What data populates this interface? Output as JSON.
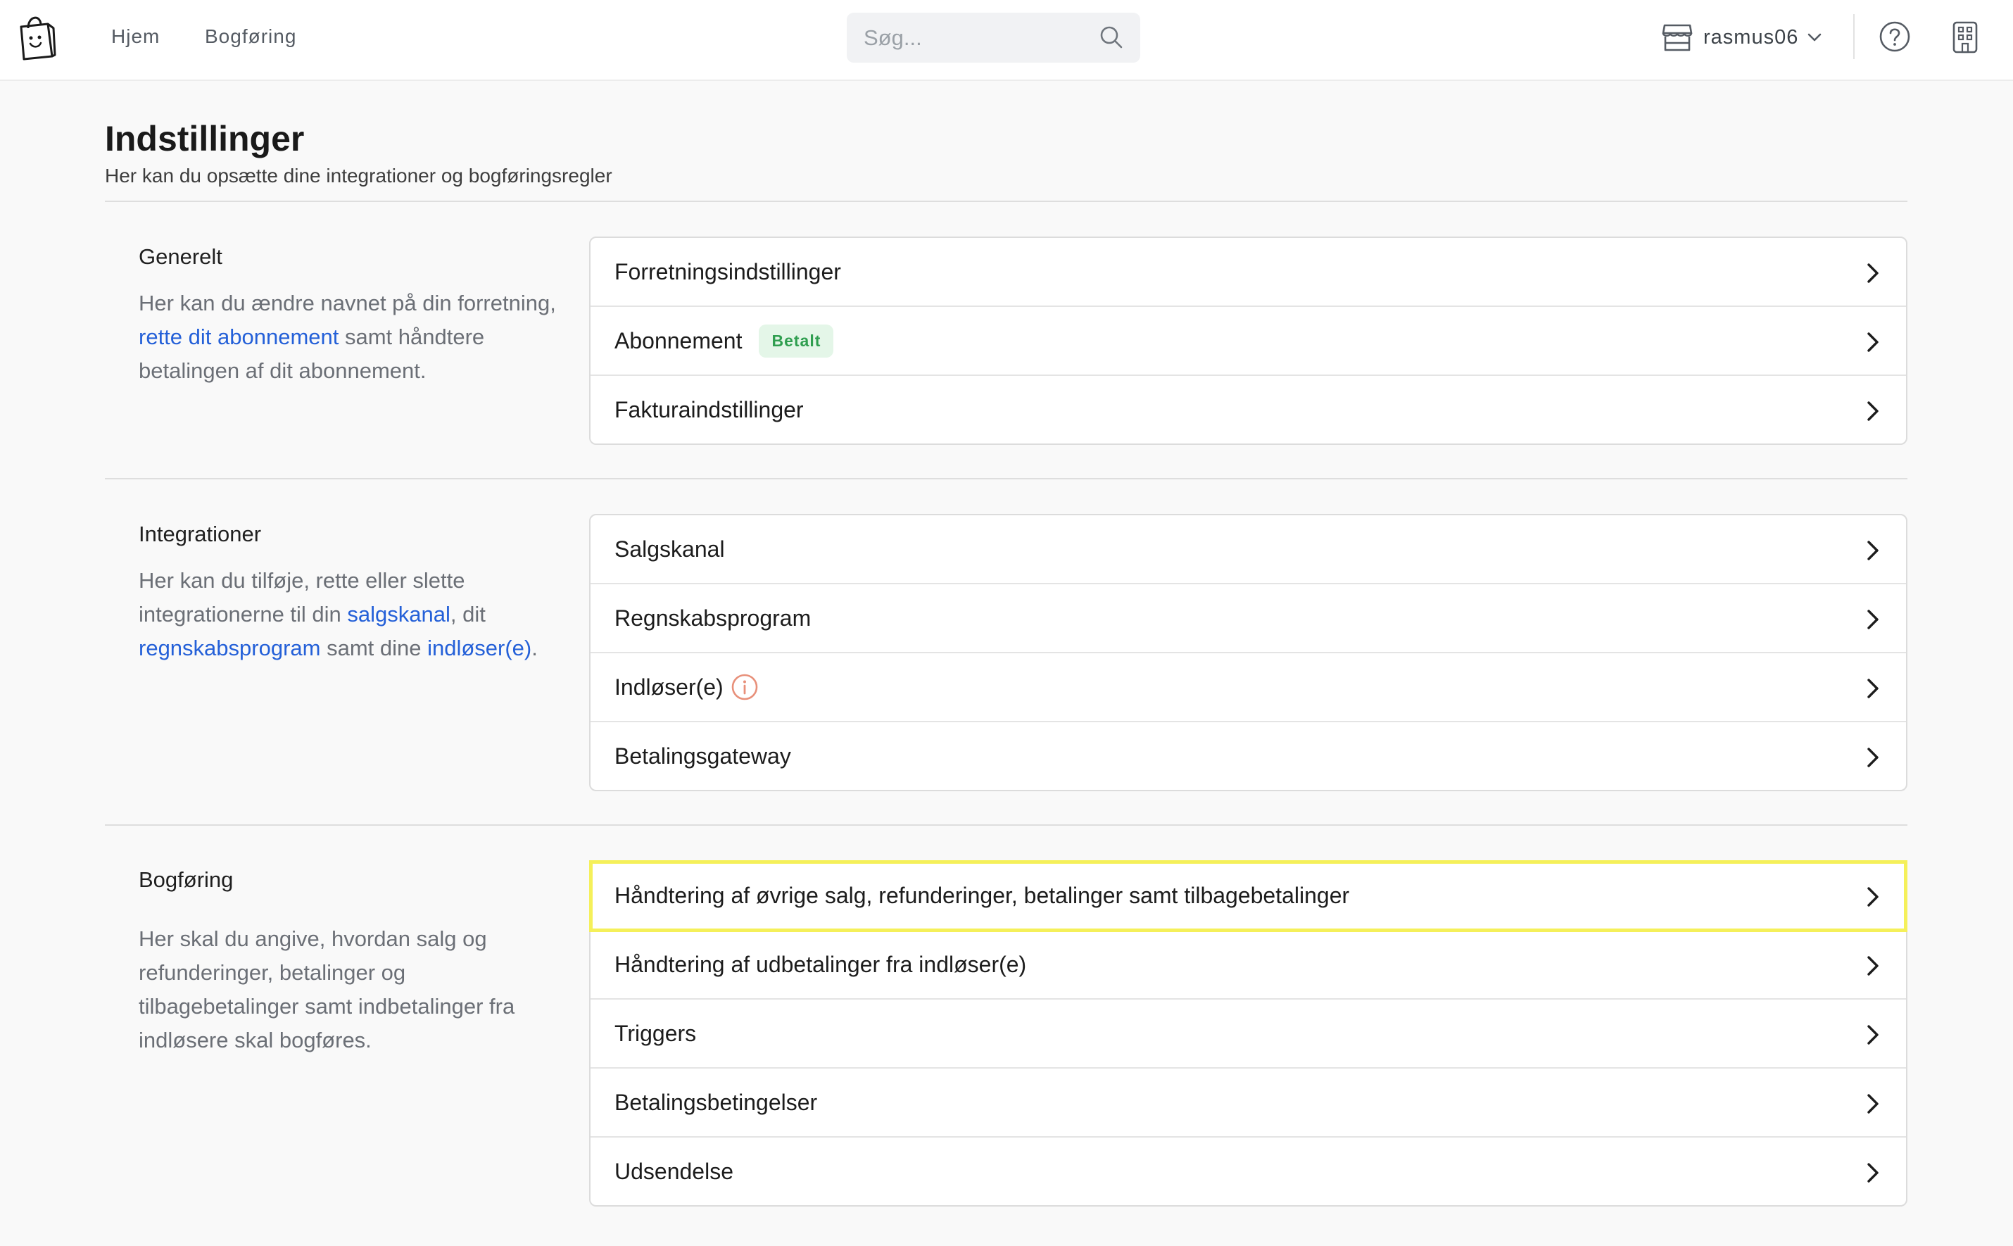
{
  "topbar": {
    "nav": [
      {
        "label": "Hjem"
      },
      {
        "label": "Bogføring"
      }
    ],
    "search": {
      "placeholder": "Søg..."
    },
    "store": {
      "name": "rasmus06"
    }
  },
  "header": {
    "title": "Indstillinger",
    "subtitle": "Her kan du opsætte dine integrationer og bogføringsregler"
  },
  "sections": {
    "generelt": {
      "title": "Generelt",
      "desc_1": "Her kan du ændre navnet på din forretning, ",
      "desc_link_1": "rette dit abonnement",
      "desc_2": " samt håndtere betalingen af dit abonnement.",
      "rows": [
        {
          "label": "Forretningsindstillinger"
        },
        {
          "label": "Abonnement",
          "badge": "Betalt"
        },
        {
          "label": "Fakturaindstillinger"
        }
      ]
    },
    "integrationer": {
      "title": "Integrationer",
      "desc_1": "Her kan du tilføje, rette eller slette integrationerne til din ",
      "desc_link_1": "salgskanal",
      "desc_2": ", dit ",
      "desc_link_2": "regnskabsprogram",
      "desc_3": " samt dine ",
      "desc_link_3": "indløser(e)",
      "desc_4": ".",
      "rows": [
        {
          "label": "Salgskanal"
        },
        {
          "label": "Regnskabsprogram"
        },
        {
          "label": "Indløser(e)",
          "icon": "info-icon"
        },
        {
          "label": "Betalingsgateway"
        }
      ]
    },
    "bogforing": {
      "title": "Bogføring",
      "desc": "Her skal du angive, hvordan salg og refunderinger, betalinger og tilbagebetalinger samt indbetalinger fra indløsere skal bogføres.",
      "rows": [
        {
          "label": "Håndtering af øvrige salg, refunderinger, betalinger samt tilbagebetalinger",
          "highlighted": true
        },
        {
          "label": "Håndtering af udbetalinger fra indløser(e)"
        },
        {
          "label": "Triggers"
        },
        {
          "label": "Betalingsbetingelser"
        },
        {
          "label": "Udsendelse"
        }
      ]
    }
  },
  "colors": {
    "link": "#2460d8",
    "badge_bg": "#e4f6e8",
    "badge_text": "#2f9e4f",
    "highlight": "#f5f05a",
    "info_icon": "#e8907a"
  }
}
